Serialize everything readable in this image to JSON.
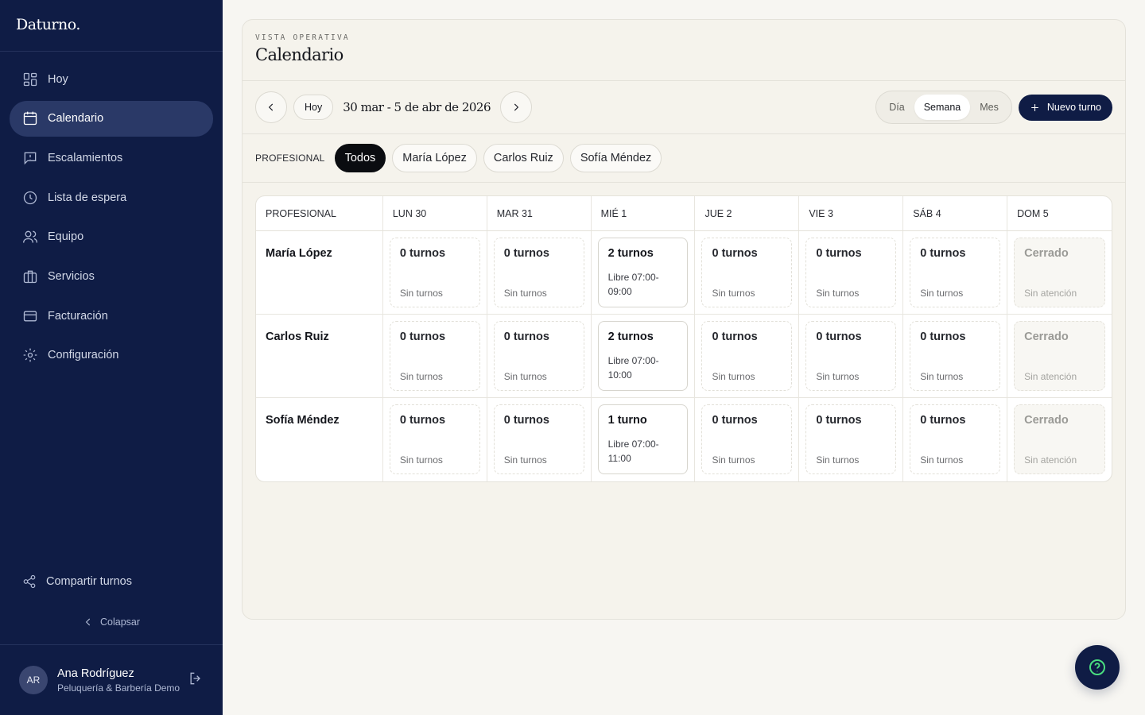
{
  "brand": "Daturno.",
  "sidebar": {
    "items": [
      {
        "label": "Hoy",
        "icon": "dashboard-icon"
      },
      {
        "label": "Calendario",
        "icon": "calendar-icon",
        "active": true
      },
      {
        "label": "Escalamientos",
        "icon": "message-alert-icon"
      },
      {
        "label": "Lista de espera",
        "icon": "clock-icon"
      },
      {
        "label": "Equipo",
        "icon": "users-icon"
      },
      {
        "label": "Servicios",
        "icon": "briefcase-icon"
      },
      {
        "label": "Facturación",
        "icon": "credit-card-icon"
      },
      {
        "label": "Configuración",
        "icon": "gear-icon"
      }
    ],
    "share_label": "Compartir turnos",
    "collapse_label": "Colapsar"
  },
  "user": {
    "initials": "AR",
    "name": "Ana Rodríguez",
    "org": "Peluquería & Barbería Demo"
  },
  "header": {
    "eyebrow": "VISTA OPERATIVA",
    "title": "Calendario"
  },
  "toolbar": {
    "today_label": "Hoy",
    "range_label": "30 mar - 5 de abr de 2026",
    "views": [
      "Día",
      "Semana",
      "Mes"
    ],
    "active_view": "Semana",
    "new_label": "Nuevo turno"
  },
  "filters": {
    "label": "PROFESIONAL",
    "options": [
      "Todos",
      "María López",
      "Carlos Ruiz",
      "Sofía Méndez"
    ],
    "active": "Todos"
  },
  "calendar": {
    "header_first": "PROFESIONAL",
    "days": [
      "LUN 30",
      "MAR 31",
      "MIÉ 1",
      "JUE 2",
      "VIE 3",
      "SÁB 4",
      "DOM 5"
    ],
    "rows": [
      {
        "name": "María López",
        "cells": [
          {
            "count": "0 turnos",
            "note": "Sin turnos",
            "state": "empty"
          },
          {
            "count": "0 turnos",
            "note": "Sin turnos",
            "state": "empty"
          },
          {
            "count": "2 turnos",
            "note": "Libre 07:00-09:00",
            "state": "has"
          },
          {
            "count": "0 turnos",
            "note": "Sin turnos",
            "state": "empty"
          },
          {
            "count": "0 turnos",
            "note": "Sin turnos",
            "state": "empty"
          },
          {
            "count": "0 turnos",
            "note": "Sin turnos",
            "state": "empty"
          },
          {
            "count": "Cerrado",
            "note": "Sin atención",
            "state": "closed"
          }
        ]
      },
      {
        "name": "Carlos Ruiz",
        "cells": [
          {
            "count": "0 turnos",
            "note": "Sin turnos",
            "state": "empty"
          },
          {
            "count": "0 turnos",
            "note": "Sin turnos",
            "state": "empty"
          },
          {
            "count": "2 turnos",
            "note": "Libre 07:00-10:00",
            "state": "has"
          },
          {
            "count": "0 turnos",
            "note": "Sin turnos",
            "state": "empty"
          },
          {
            "count": "0 turnos",
            "note": "Sin turnos",
            "state": "empty"
          },
          {
            "count": "0 turnos",
            "note": "Sin turnos",
            "state": "empty"
          },
          {
            "count": "Cerrado",
            "note": "Sin atención",
            "state": "closed"
          }
        ]
      },
      {
        "name": "Sofía Méndez",
        "cells": [
          {
            "count": "0 turnos",
            "note": "Sin turnos",
            "state": "empty"
          },
          {
            "count": "0 turnos",
            "note": "Sin turnos",
            "state": "empty"
          },
          {
            "count": "1 turno",
            "note": "Libre 07:00-11:00",
            "state": "has"
          },
          {
            "count": "0 turnos",
            "note": "Sin turnos",
            "state": "empty"
          },
          {
            "count": "0 turnos",
            "note": "Sin turnos",
            "state": "empty"
          },
          {
            "count": "0 turnos",
            "note": "Sin turnos",
            "state": "empty"
          },
          {
            "count": "Cerrado",
            "note": "Sin atención",
            "state": "closed"
          }
        ]
      }
    ]
  },
  "help_icon": "help-circle-icon",
  "colors": {
    "sidebar_bg": "#0f1c45",
    "accent": "#0f1c45",
    "help_icon": "#4ade80"
  }
}
